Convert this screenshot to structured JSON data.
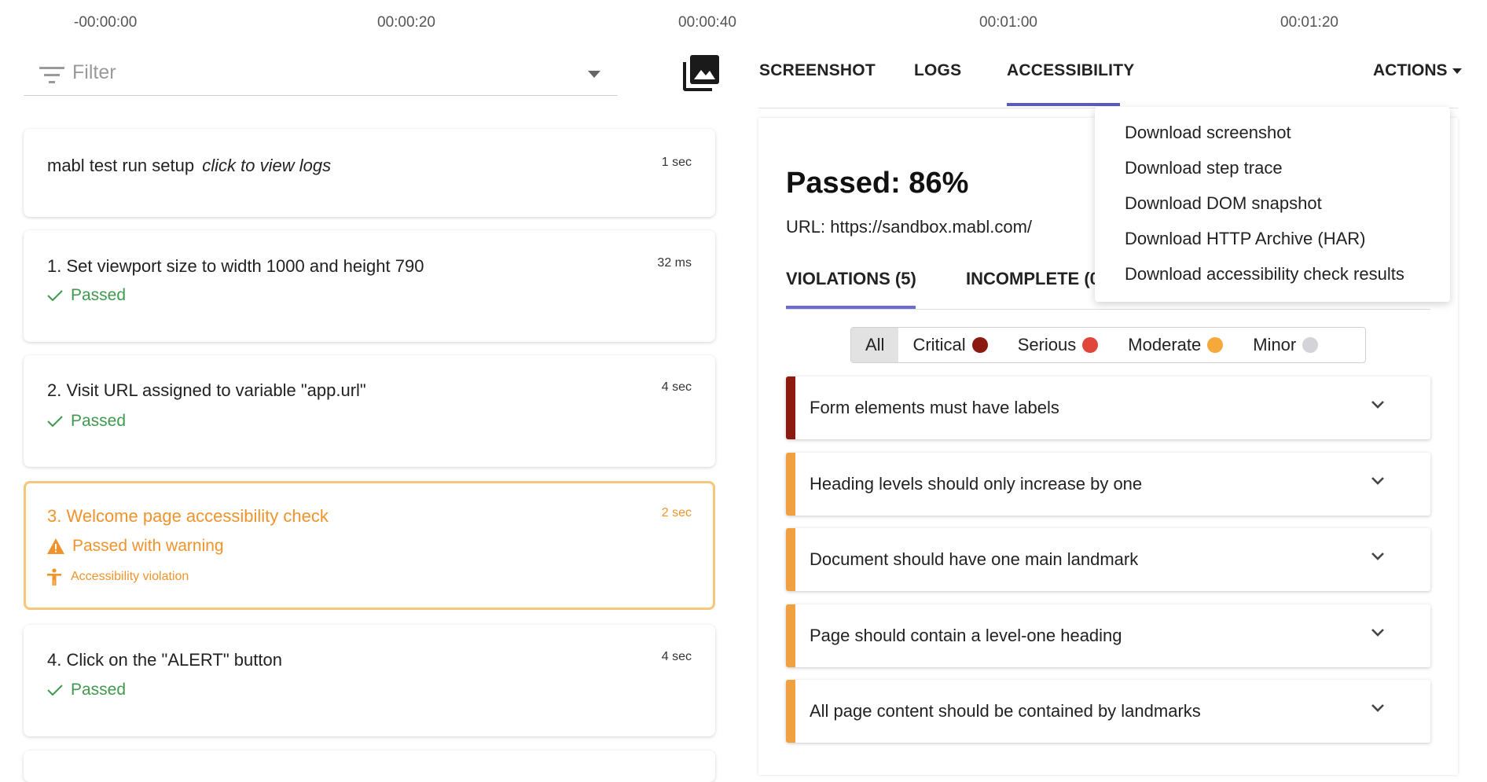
{
  "timeline": {
    "ticks": [
      "-00:00:00",
      "00:00:20",
      "00:00:40",
      "00:01:00",
      "00:01:20"
    ]
  },
  "filter": {
    "placeholder": "Filter"
  },
  "steps": [
    {
      "title": "mabl test run setup",
      "title_suffix": "click to view logs",
      "time": "1 sec"
    },
    {
      "title": "1. Set viewport size to width 1000 and height 790",
      "time": "32 ms",
      "status": "Passed"
    },
    {
      "title": "2. Visit URL assigned to variable \"app.url\"",
      "time": "4 sec",
      "status": "Passed"
    },
    {
      "title": "3. Welcome page accessibility check",
      "time": "2 sec",
      "status": "Passed with warning",
      "detail": "Accessibility violation"
    },
    {
      "title": "4. Click on the \"ALERT\" button",
      "time": "4 sec",
      "status": "Passed"
    }
  ],
  "tabs": {
    "screenshot": "SCREENSHOT",
    "logs": "LOGS",
    "accessibility": "ACCESSIBILITY",
    "actions": "ACTIONS"
  },
  "accessibility": {
    "passed": "Passed: 86%",
    "url": "URL: https://sandbox.mabl.com/",
    "sub_tabs": {
      "violations": "VIOLATIONS (5)",
      "incomplete": "INCOMPLETE (0"
    },
    "severity": [
      {
        "label": "All"
      },
      {
        "label": "Critical",
        "color": "#8b1a10"
      },
      {
        "label": "Serious",
        "color": "#e0473a"
      },
      {
        "label": "Moderate",
        "color": "#f4a93a"
      },
      {
        "label": "Minor",
        "color": "#d4d4d8"
      }
    ],
    "violations": [
      {
        "label": "Form elements must have labels",
        "color": "#8b1a10"
      },
      {
        "label": "Heading levels should only increase by one",
        "color": "#f0a040"
      },
      {
        "label": "Document should have one main landmark",
        "color": "#f0a040"
      },
      {
        "label": "Page should contain a level-one heading",
        "color": "#f0a040"
      },
      {
        "label": "All page content should be contained by landmarks",
        "color": "#f0a040"
      }
    ]
  },
  "actions_menu": {
    "items": [
      "Download screenshot",
      "Download step trace",
      "Download DOM snapshot",
      "Download HTTP Archive (HAR)",
      "Download accessibility check results"
    ]
  }
}
